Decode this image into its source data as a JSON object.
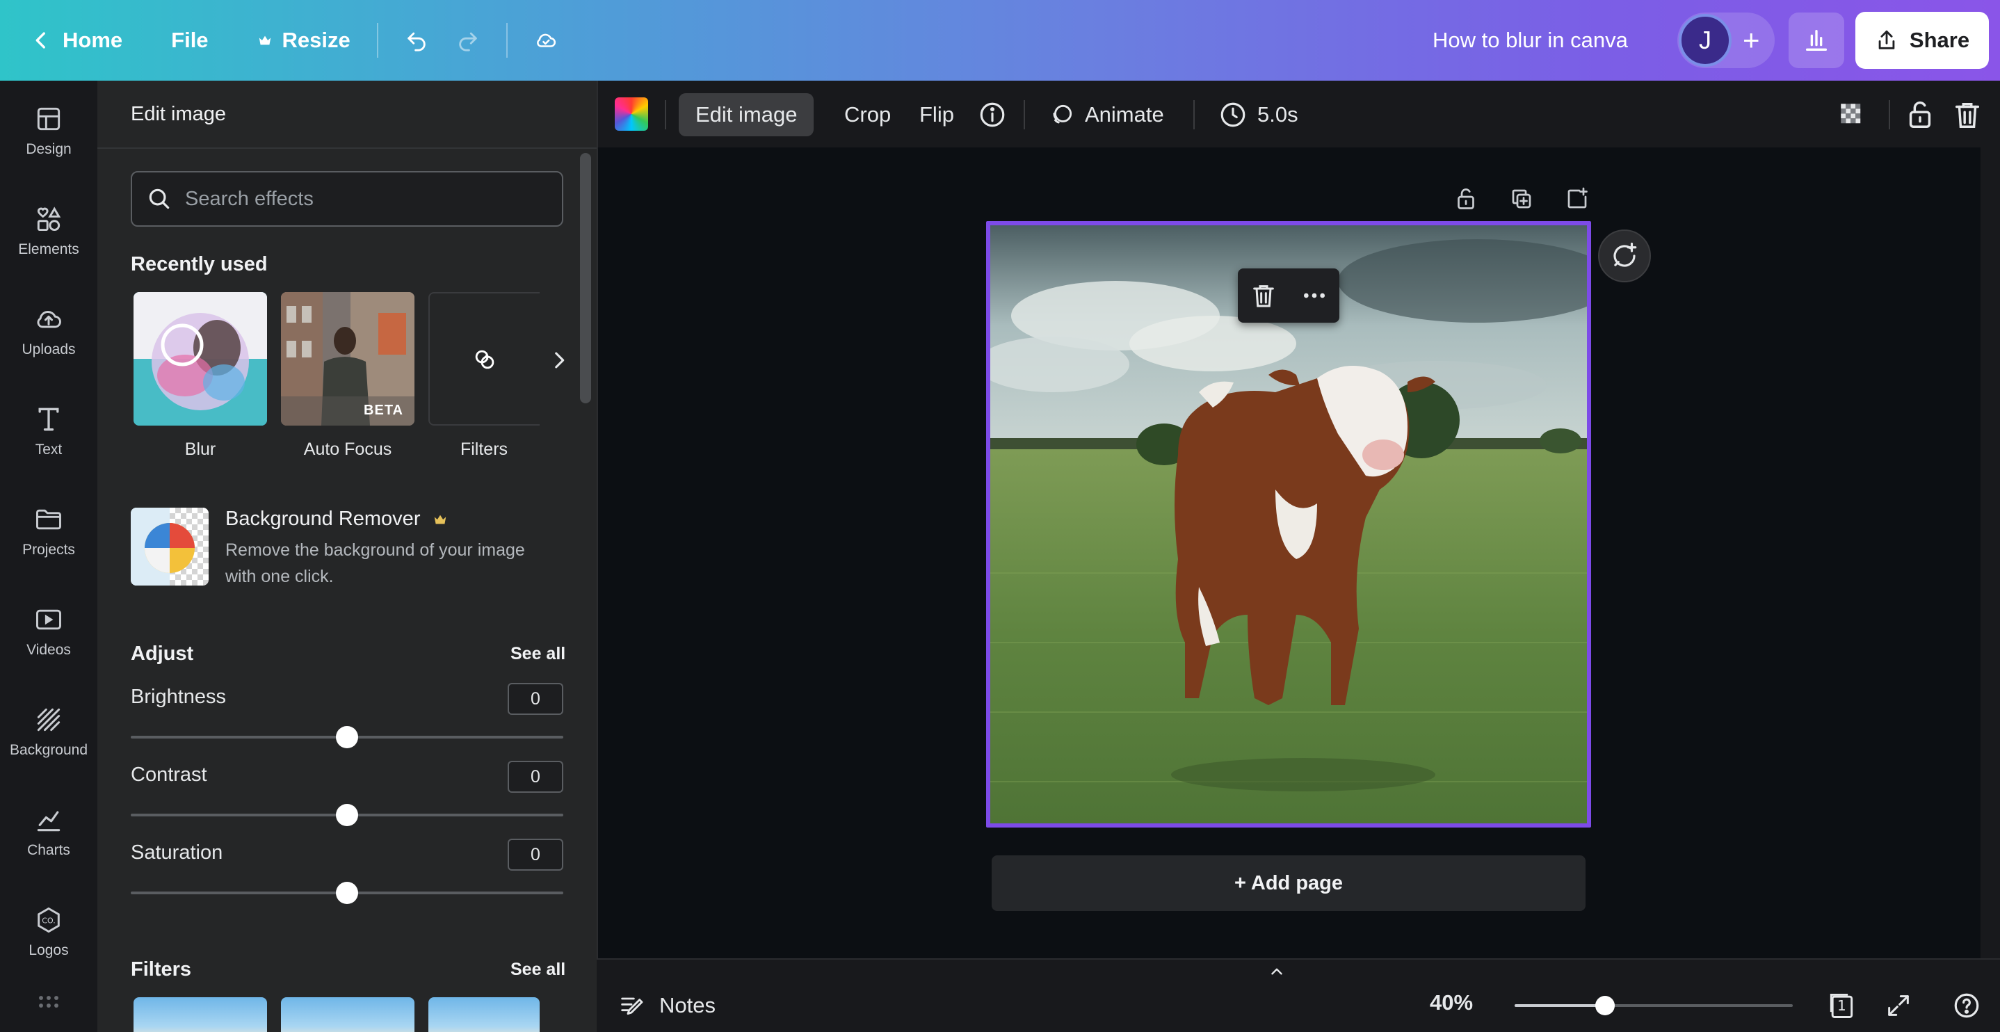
{
  "topbar": {
    "home_label": "Home",
    "file_label": "File",
    "resize_label": "Resize",
    "doc_title": "How to blur in canva",
    "avatar_initial": "J",
    "share_label": "Share"
  },
  "rail": {
    "items": [
      {
        "label": "Design",
        "icon": "design-icon"
      },
      {
        "label": "Elements",
        "icon": "elements-icon"
      },
      {
        "label": "Uploads",
        "icon": "uploads-icon"
      },
      {
        "label": "Text",
        "icon": "text-icon"
      },
      {
        "label": "Projects",
        "icon": "projects-icon"
      },
      {
        "label": "Videos",
        "icon": "videos-icon"
      },
      {
        "label": "Background",
        "icon": "background-icon"
      },
      {
        "label": "Charts",
        "icon": "charts-icon"
      },
      {
        "label": "Logos",
        "icon": "logos-icon"
      }
    ]
  },
  "panel": {
    "title": "Edit image",
    "search_placeholder": "Search effects",
    "recently_used_title": "Recently used",
    "recent": [
      {
        "label": "Blur"
      },
      {
        "label": "Auto Focus",
        "badge": "BETA"
      },
      {
        "label": "Filters"
      }
    ],
    "bg_remover": {
      "title": "Background Remover",
      "desc": "Remove the background of your image with one click."
    },
    "adjust": {
      "title": "Adjust",
      "see_all": "See all",
      "sliders": [
        {
          "label": "Brightness",
          "value": "0",
          "position": 0.5
        },
        {
          "label": "Contrast",
          "value": "0",
          "position": 0.5
        },
        {
          "label": "Saturation",
          "value": "0",
          "position": 0.5
        }
      ]
    },
    "filters": {
      "title": "Filters",
      "see_all": "See all"
    }
  },
  "toolbar": {
    "edit_image": "Edit image",
    "crop": "Crop",
    "flip": "Flip",
    "animate": "Animate",
    "duration": "5.0s"
  },
  "canvas": {
    "add_page": "+ Add page"
  },
  "bottom": {
    "notes": "Notes",
    "zoom": "40%",
    "zoom_level": 0.4,
    "page_number": "1"
  },
  "colors": {
    "accent": "#7d4be8",
    "panel_bg": "#252627",
    "rail_bg": "#18191c",
    "canvas_bg": "#0c0f13"
  }
}
